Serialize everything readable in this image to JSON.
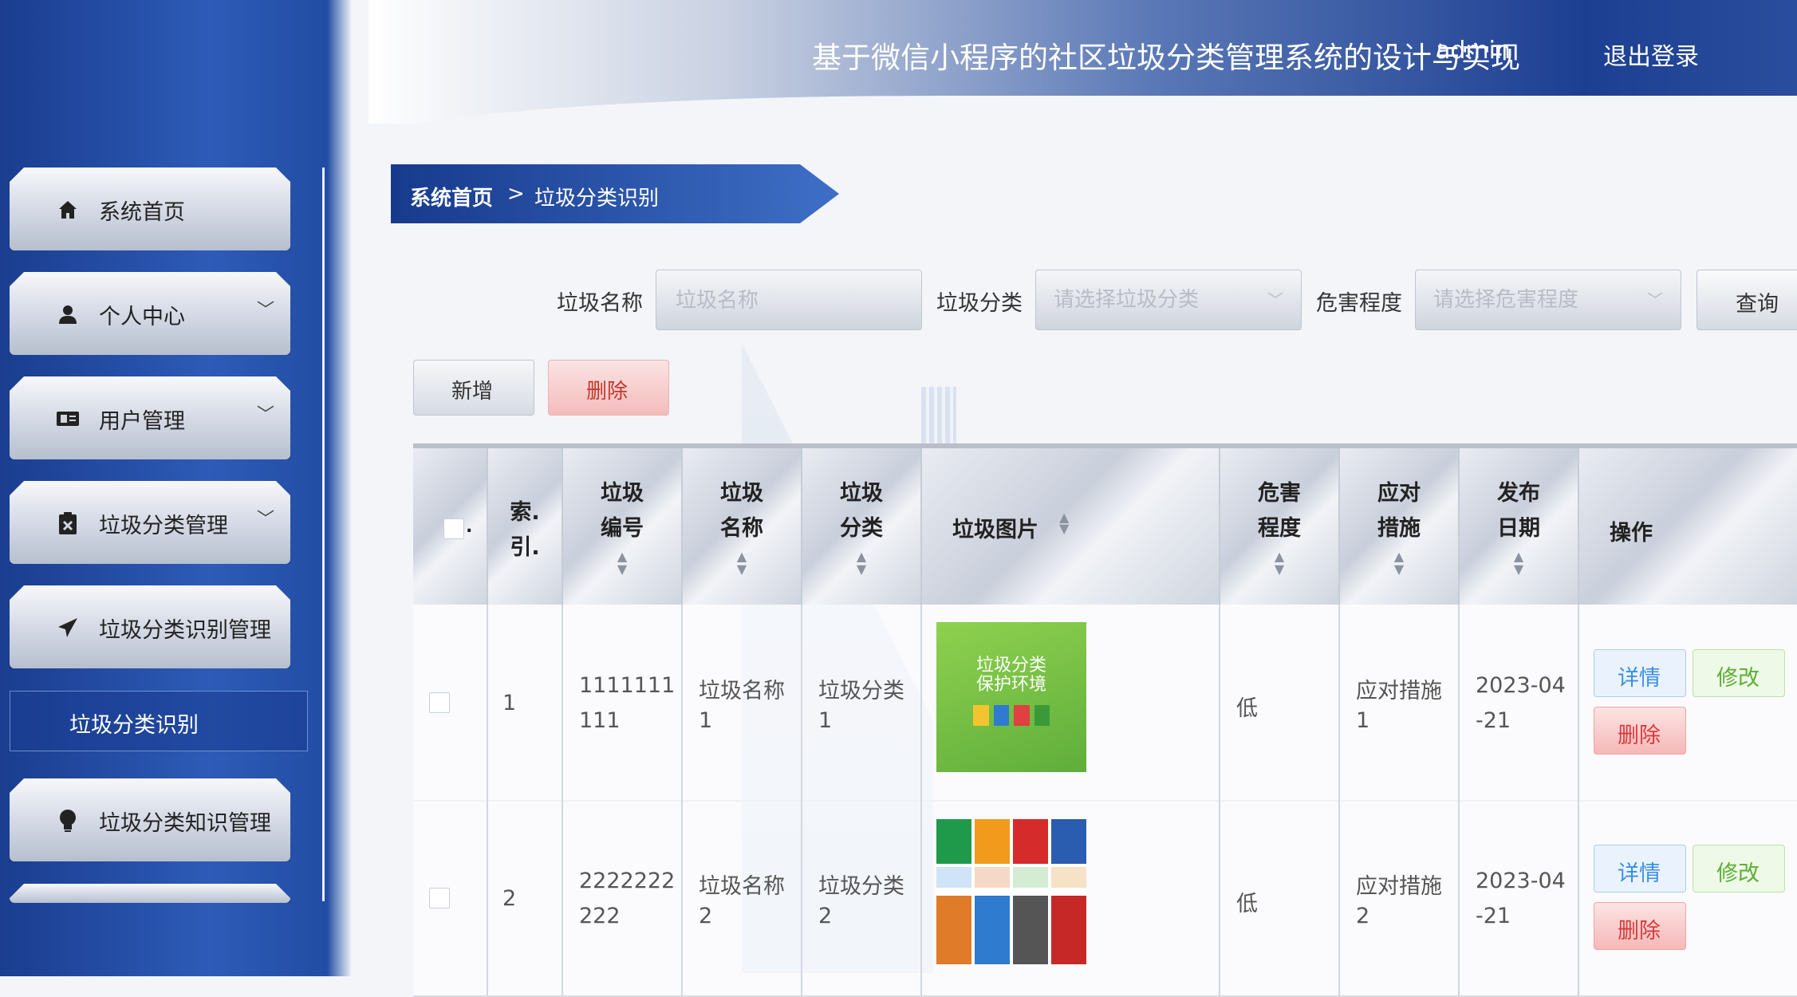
{
  "header": {
    "title": "基于微信小程序的社区垃圾分类管理系统的设计与实现",
    "user": "admin",
    "logout_label": "退出登录"
  },
  "sidebar": {
    "items": [
      {
        "label": "系统首页",
        "icon": "home-icon",
        "has_children": false
      },
      {
        "label": "个人中心",
        "icon": "user-icon",
        "has_children": true
      },
      {
        "label": "用户管理",
        "icon": "users-icon",
        "has_children": true
      },
      {
        "label": "垃圾分类管理",
        "icon": "clipboard-icon",
        "has_children": true
      },
      {
        "label": "垃圾分类识别管理",
        "icon": "send-icon",
        "has_children": false
      },
      {
        "label": "垃圾分类知识管理",
        "icon": "bulb-icon",
        "has_children": false
      }
    ],
    "active_submenu": "垃圾分类识别"
  },
  "breadcrumb": {
    "home": "系统首页",
    "separator": ">",
    "current": "垃圾分类识别"
  },
  "search": {
    "name_label": "垃圾名称",
    "name_placeholder": "垃圾名称",
    "category_label": "垃圾分类",
    "category_placeholder": "请选择垃圾分类",
    "hazard_label": "危害程度",
    "hazard_placeholder": "请选择危害程度",
    "query_label": "查询"
  },
  "actions": {
    "add_label": "新增",
    "delete_label": "删除"
  },
  "table": {
    "columns": [
      {
        "line1": "索.",
        "line2": "引."
      },
      {
        "line1": "垃圾",
        "line2": "编号"
      },
      {
        "line1": "垃圾",
        "line2": "名称"
      },
      {
        "line1": "垃圾",
        "line2": "分类"
      },
      {
        "line1": "垃圾图片",
        "line2": ""
      },
      {
        "line1": "危害",
        "line2": "程度"
      },
      {
        "line1": "应对",
        "line2": "措施"
      },
      {
        "line1": "发布",
        "line2": "日期"
      },
      {
        "line1": "操作",
        "line2": ""
      }
    ],
    "rows": [
      {
        "index": "1",
        "code_1": "1111111",
        "code_2": "111",
        "name_1": "垃圾名称",
        "name_2": "1",
        "cat_1": "垃圾分类",
        "cat_2": "1",
        "image_caption_1": "垃圾分类",
        "image_caption_2": "保护环境",
        "hazard": "低",
        "measure_1": "应对措施",
        "measure_2": "1",
        "date_1": "2023-04",
        "date_2": "-21",
        "detail": "详情",
        "edit": "修改",
        "delete": "删除"
      },
      {
        "index": "2",
        "code_1": "2222222",
        "code_2": "222",
        "name_1": "垃圾名称",
        "name_2": "2",
        "cat_1": "垃圾分类",
        "cat_2": "2",
        "hazard": "低",
        "measure_1": "应对措施",
        "measure_2": "2",
        "date_1": "2023-04",
        "date_2": "-21",
        "detail": "详情",
        "edit": "修改",
        "delete": "删除"
      }
    ]
  },
  "colors": {
    "sidebar": "#1f4aa0",
    "breadcrumb": "#173a8c",
    "detail": "#3a8ee6",
    "edit": "#5daf34",
    "danger": "#d63b3b"
  }
}
